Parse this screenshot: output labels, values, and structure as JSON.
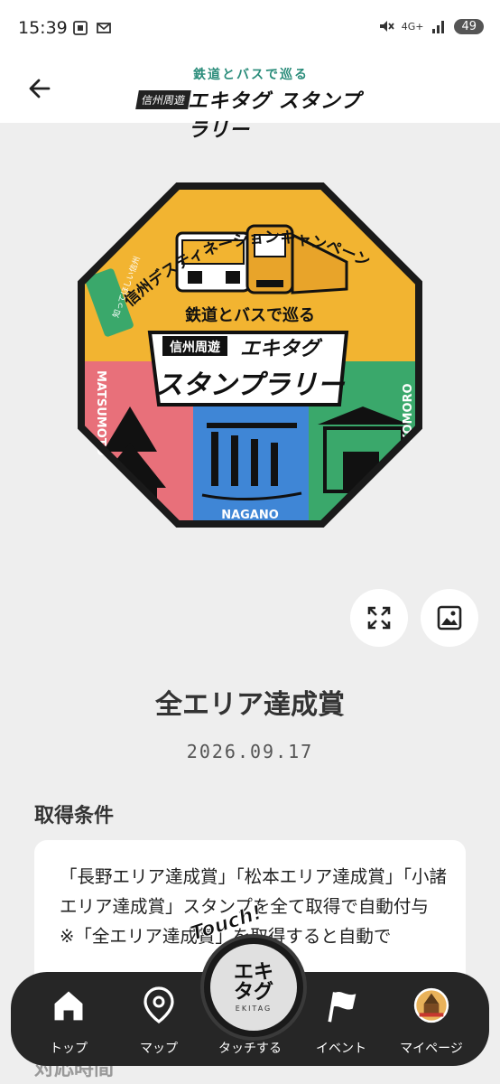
{
  "status_bar": {
    "time": "15:39",
    "network": "4G+",
    "battery": "49"
  },
  "header": {
    "logo_tagline": "鉄道とバスで巡る",
    "logo_small": "信州周遊",
    "logo_main": "エキタグ スタンプラリー"
  },
  "stamp": {
    "arc_text": "信州デスティネーションキャンペーン プレキャンペーン",
    "side_badge": "知ってほしい信州",
    "tagline": "鉄道とバスで巡る",
    "banner_small": "信州周遊",
    "banner_main_1": "エキタグ",
    "banner_main_2": "スタンプラリー",
    "area_left": "MATSUMOTO",
    "area_center": "NAGANO",
    "area_right": "KOMORO",
    "colors": {
      "frame": "#1a1a1a",
      "top": "#f2b431",
      "left": "#e8707a",
      "center": "#3f86d6",
      "right": "#3aa86b"
    }
  },
  "main": {
    "title": "全エリア達成賞",
    "date": "2026.09.17",
    "condition_heading": "取得条件",
    "condition_text": "「長野エリア達成賞」「松本エリア達成賞」「小諸エリア達成賞」スタンプを全て取得で自動付与\n※「全エリア達成賞」を取得すると自動で",
    "next_heading": "対応時間"
  },
  "nav": {
    "items": [
      {
        "label": "トップ",
        "icon": "home-icon"
      },
      {
        "label": "マップ",
        "icon": "map-pin-icon"
      },
      {
        "label": "タッチする",
        "icon": "ekitag-touch-icon"
      },
      {
        "label": "イベント",
        "icon": "flag-icon"
      },
      {
        "label": "マイページ",
        "icon": "avatar-stamp-icon"
      }
    ],
    "touch_word": "Touch!",
    "touch_logo_1": "エキ",
    "touch_logo_2": "タグ",
    "touch_sub": "EKITAG"
  }
}
